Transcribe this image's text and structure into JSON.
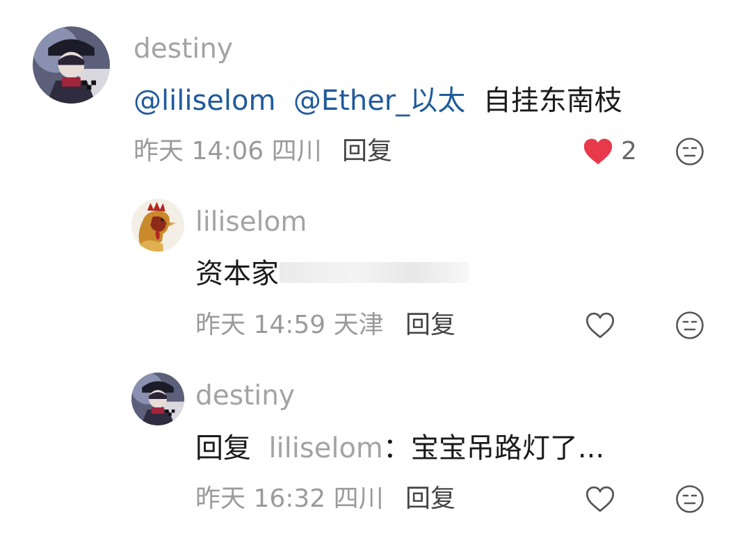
{
  "colors": {
    "username": "#a3a3a3",
    "mention": "#1f5a9c",
    "text": "#1a1a1a",
    "meta": "#9a9a9a",
    "reply": "#444444",
    "liked_heart": "#e8394a"
  },
  "comments": [
    {
      "username": "destiny",
      "mentions": [
        "@liliselom",
        "@Ether_以太"
      ],
      "text": "自挂东南枝",
      "date": "昨天 14:06",
      "location": "四川",
      "reply_label": "回复",
      "like_count": "2",
      "liked": true,
      "avatar_icon": "anime-character-avatar"
    },
    {
      "username": "liliselom",
      "text": "资本家",
      "date": "昨天 14:59",
      "location": "天津",
      "reply_label": "回复",
      "liked": false,
      "avatar_icon": "rooster-avatar"
    },
    {
      "username": "destiny",
      "reply_prefix": "回复",
      "quoted_user": "liliselom",
      "separator": "：",
      "text": "宝宝吊路灯了...",
      "date": "昨天 16:32",
      "location": "四川",
      "reply_label": "回复",
      "liked": false,
      "avatar_icon": "anime-character-avatar"
    }
  ],
  "icons": {
    "like": "heart-icon",
    "more": "neutral-face-icon"
  }
}
